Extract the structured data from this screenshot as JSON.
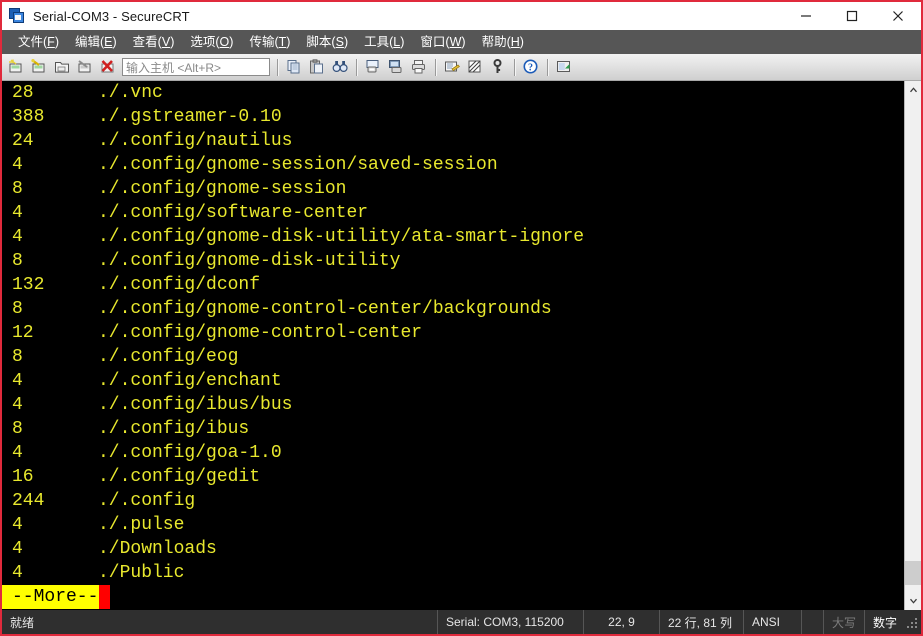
{
  "window": {
    "title": "Serial-COM3 - SecureCRT",
    "app_icon": "securecrt-icon",
    "border_color": "#e02a3c",
    "controls": {
      "minimize": "minimize",
      "maximize": "maximize",
      "close": "close"
    }
  },
  "menubar": {
    "items": [
      {
        "label": "文件(F)",
        "mnemonic": "F"
      },
      {
        "label": "编辑(E)",
        "mnemonic": "E"
      },
      {
        "label": "查看(V)",
        "mnemonic": "V"
      },
      {
        "label": "选项(O)",
        "mnemonic": "O"
      },
      {
        "label": "传输(T)",
        "mnemonic": "T"
      },
      {
        "label": "脚本(S)",
        "mnemonic": "S"
      },
      {
        "label": "工具(L)",
        "mnemonic": "L"
      },
      {
        "label": "窗口(W)",
        "mnemonic": "W"
      },
      {
        "label": "帮助(H)",
        "mnemonic": "H"
      }
    ]
  },
  "toolbar": {
    "host_input": {
      "value": "",
      "placeholder": "输入主机 <Alt+R>"
    },
    "icons_group1": [
      "new-session-icon",
      "connect-session-icon",
      "open-folder-icon",
      "connect-sftp-icon",
      "disconnect-icon"
    ],
    "icons_group2": [
      "copy-icon",
      "paste-icon",
      "find-icon"
    ],
    "icons_group3": [
      "print-screen-icon",
      "log-session-icon",
      "print-icon"
    ],
    "icons_group4": [
      "session-options-icon",
      "toggle-raw-icon",
      "key-icon"
    ],
    "icons_group5": [
      "help-icon"
    ],
    "icons_group6": [
      "session-manager-icon"
    ]
  },
  "terminal": {
    "fg_color": "#e8e82e",
    "bg_color": "#000000",
    "lines": [
      {
        "size": "28",
        "path": "./.vnc"
      },
      {
        "size": "388",
        "path": "./.gstreamer-0.10"
      },
      {
        "size": "24",
        "path": "./.config/nautilus"
      },
      {
        "size": "4",
        "path": "./.config/gnome-session/saved-session"
      },
      {
        "size": "8",
        "path": "./.config/gnome-session"
      },
      {
        "size": "4",
        "path": "./.config/software-center"
      },
      {
        "size": "4",
        "path": "./.config/gnome-disk-utility/ata-smart-ignore"
      },
      {
        "size": "8",
        "path": "./.config/gnome-disk-utility"
      },
      {
        "size": "132",
        "path": "./.config/dconf"
      },
      {
        "size": "8",
        "path": "./.config/gnome-control-center/backgrounds"
      },
      {
        "size": "12",
        "path": "./.config/gnome-control-center"
      },
      {
        "size": "8",
        "path": "./.config/eog"
      },
      {
        "size": "4",
        "path": "./.config/enchant"
      },
      {
        "size": "4",
        "path": "./.config/ibus/bus"
      },
      {
        "size": "8",
        "path": "./.config/ibus"
      },
      {
        "size": "4",
        "path": "./.config/goa-1.0"
      },
      {
        "size": "16",
        "path": "./.config/gedit"
      },
      {
        "size": "244",
        "path": "./.config"
      },
      {
        "size": "4",
        "path": "./.pulse"
      },
      {
        "size": "4",
        "path": "./Downloads"
      },
      {
        "size": "4",
        "path": "./Public"
      }
    ],
    "more_prompt": {
      "label": "--More--",
      "bg_color": "#ffff00",
      "fg_color": "#000000",
      "cursor_color": "#ff0000"
    }
  },
  "statusbar": {
    "ready": "就绪",
    "serial": "Serial: COM3, 115200",
    "cursor": "22,  9",
    "dimensions": "22 行, 81 列",
    "emulation": "ANSI",
    "caps": "大写",
    "num": "数字"
  }
}
